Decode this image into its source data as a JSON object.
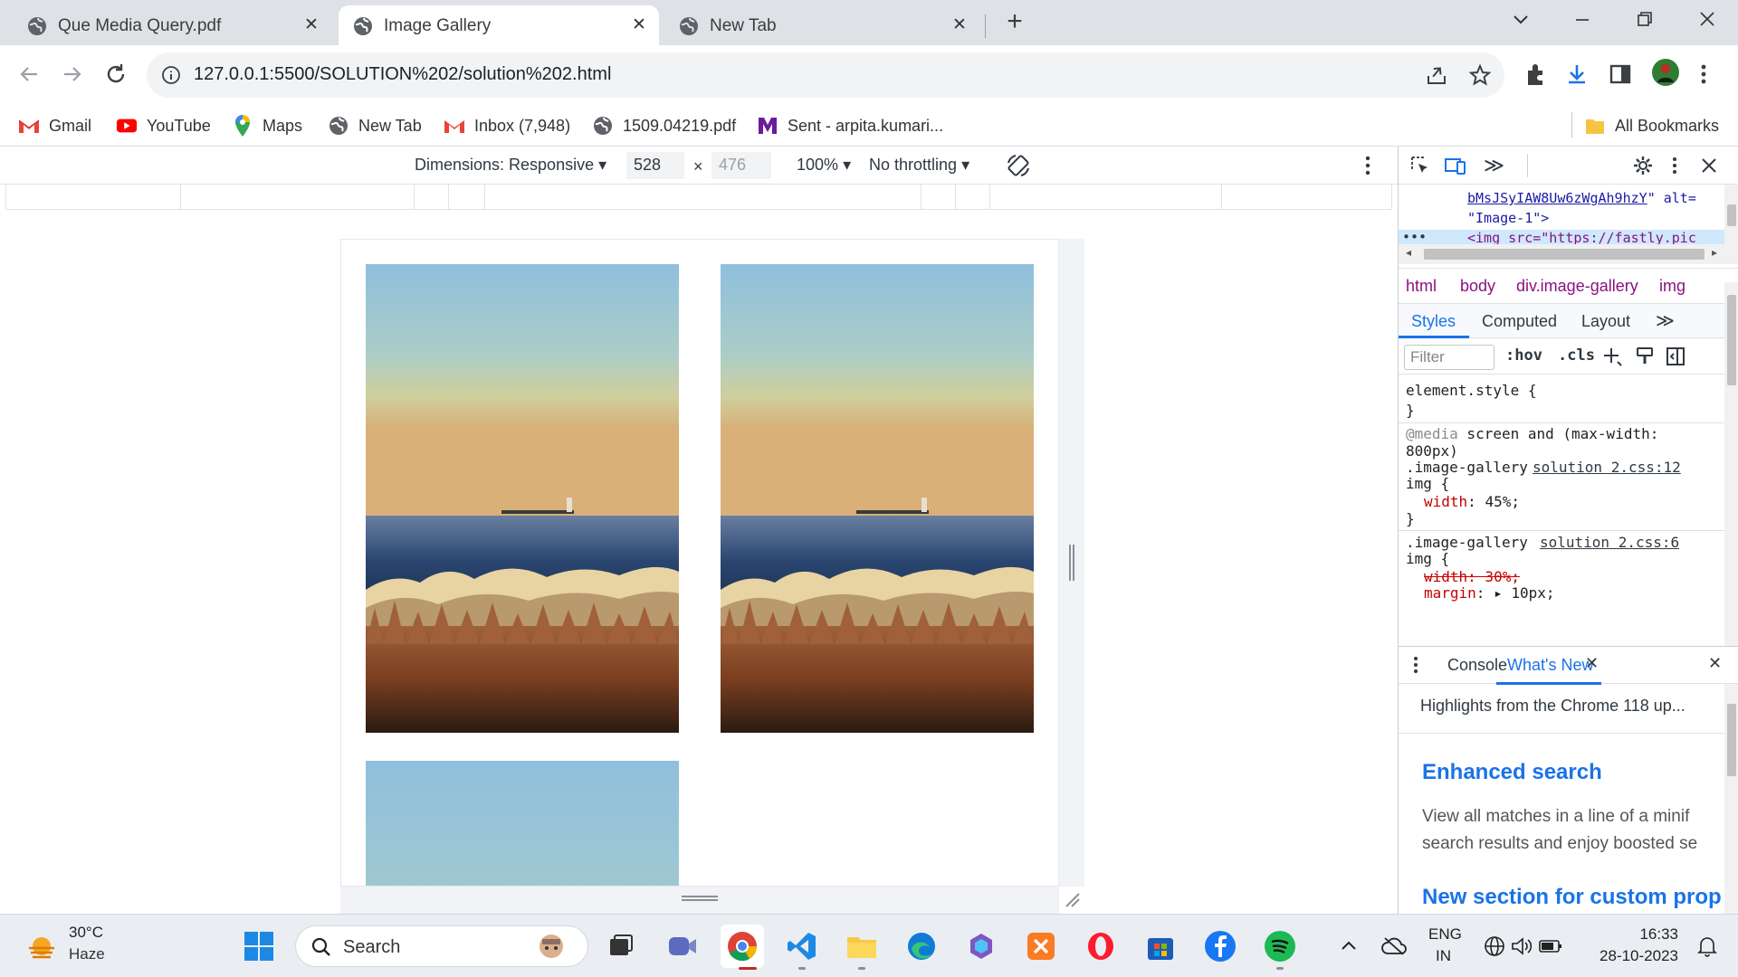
{
  "tabs": [
    {
      "title": "Que Media Query.pdf",
      "active": false
    },
    {
      "title": "Image Gallery",
      "active": true
    },
    {
      "title": "New Tab",
      "active": false
    }
  ],
  "address": {
    "url": "127.0.0.1:5500/SOLUTION%202/solution%202.html"
  },
  "bookmarks": [
    {
      "label": "Gmail",
      "icon": "gmail-icon"
    },
    {
      "label": "YouTube",
      "icon": "youtube-icon"
    },
    {
      "label": "Maps",
      "icon": "maps-icon"
    },
    {
      "label": "New Tab",
      "icon": "globe-icon"
    },
    {
      "label": "Inbox (7,948)",
      "icon": "gmail-icon"
    },
    {
      "label": "1509.04219.pdf",
      "icon": "globe-icon"
    },
    {
      "label": "Sent - arpita.kumari...",
      "icon": "mail-icon"
    }
  ],
  "all_bookmarks": "All Bookmarks",
  "device_toolbar": {
    "dimensions_label": "Dimensions: Responsive",
    "width": "528",
    "times": "×",
    "height": "476",
    "zoom": "100%",
    "throttle": "No throttling"
  },
  "devtools": {
    "dom_lines": [
      "bMsJSyIAW8Uw6zWgAh9hzY",
      "\" alt=",
      "\"Image-1\">",
      "<img src=\"https://fastly.pic"
    ],
    "breadcrumbs": [
      "html",
      "body",
      "div.image-gallery",
      "img"
    ],
    "subtabs": [
      "Styles",
      "Computed",
      "Layout"
    ],
    "filter_placeholder": "Filter",
    "hov": ":hov",
    "cls": ".cls",
    "styles": {
      "element_style": "element.style {",
      "close_brace": "}",
      "media_at": "@media",
      "media_rest": " screen and (max-width:",
      "media_line2": "800px)",
      "rule1_selector": ".image-gallery",
      "rule1_selector2": "img {",
      "rule1_source": "solution 2.css:12",
      "rule1_prop": "width",
      "rule1_value": ": 45%;",
      "rule2_selector": ".image-gallery",
      "rule2_selector2": "img {",
      "rule2_source": "solution 2.css:6",
      "rule2_strike": "width: 30%;",
      "rule2_prop": "margin",
      "rule2_value": ": ▸ 10px;"
    },
    "drawer_tabs": [
      "Console",
      "What's New"
    ],
    "whats_new": {
      "highlight": "Highlights from the Chrome 118 up...",
      "h1": "Enhanced search",
      "p1": "View all matches in a line of a minif",
      "p2": "search results and enjoy boosted se",
      "h2": "New section for custom prop"
    }
  },
  "taskbar": {
    "temperature": "30°C",
    "weather": "Haze",
    "search_placeholder": "Search",
    "lang1": "ENG",
    "lang2": "IN",
    "time": "16:33",
    "date": "28-10-2023"
  }
}
